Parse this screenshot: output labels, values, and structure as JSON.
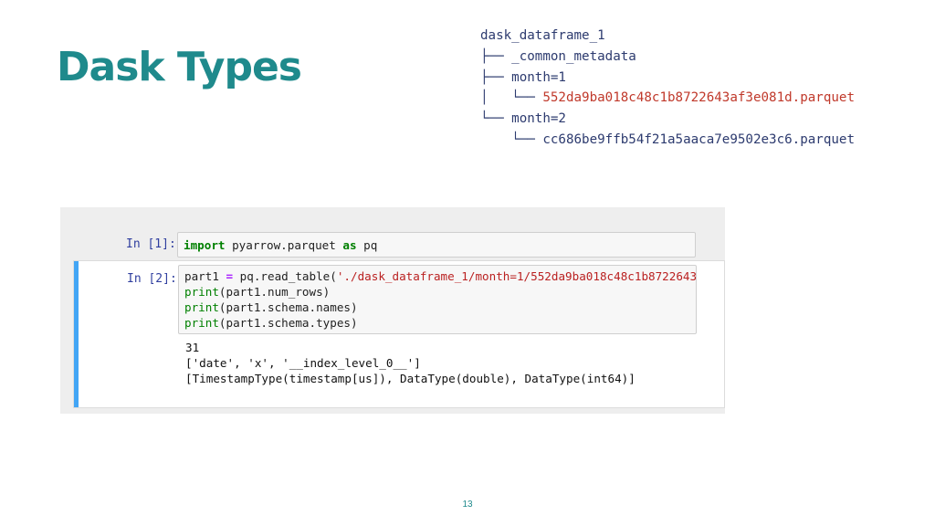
{
  "slide": {
    "title": "Dask Types",
    "page_number": "13"
  },
  "tree": {
    "root": "dask_dataframe_1",
    "line1_prefix": "├── ",
    "line1": "_common_metadata",
    "line2_prefix": "├── ",
    "line2": "month=1",
    "line3_prefix": "│   └── ",
    "line3": "552da9ba018c48c1b8722643af3e081d.parquet",
    "line4_prefix": "└── ",
    "line4": "month=2",
    "line5_prefix": "    └── ",
    "line5": "cc686be9ffb54f21a5aaca7e9502e3c6.parquet"
  },
  "notebook": {
    "cell1": {
      "prompt": "In [1]:",
      "kw_import": "import",
      "module": " pyarrow.parquet ",
      "kw_as": "as",
      "alias": " pq"
    },
    "cell2": {
      "prompt": "In [2]:",
      "l1_a": "part1 ",
      "l1_eq": "=",
      "l1_b": " pq.read_table(",
      "l1_str": "'./dask_dataframe_1/month=1/552da9ba018c48c1b8722643",
      "l2_fn": "print",
      "l2_rest": "(part1.num_rows)",
      "l3_fn": "print",
      "l3_rest": "(part1.schema.names)",
      "l4_fn": "print",
      "l4_rest": "(part1.schema.types)",
      "out1": "31",
      "out2": "['date', 'x', '__index_level_0__']",
      "out3": "[TimestampType(timestamp[us]), DataType(double), DataType(int64)]"
    }
  }
}
